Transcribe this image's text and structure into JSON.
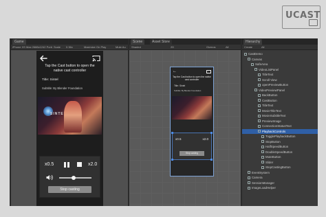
{
  "logo": {
    "text": "UCAST"
  },
  "game": {
    "tab_label": "Game",
    "toolbar": [
      "iPhone XS Max 2688x1242 Portr",
      "Scale",
      "0.36x",
      "Maximize On Play",
      "Mute Au"
    ],
    "instructions": "Tap the Cast button to open the native cast controller",
    "movie_title": "Title: Sintel",
    "movie_subtitle": "Subtitle: By Blender Foundation",
    "video_brand": "SINTEL",
    "speed_down": "x0.5",
    "speed_up": "x2.0",
    "volume_level": 0.45,
    "stop_casting": "Stop casting"
  },
  "scene": {
    "tab_label": "Scene",
    "tab2_label": "Asset Store",
    "toolbar": [
      "Shaded",
      "2D",
      "Gizmos",
      "All"
    ],
    "mini": {
      "instructions": "Tap the Cast button to open the native cast controller",
      "title": "Title: Sintel",
      "subtitle": "Subtitle: By Blender Foundation",
      "speed_down": "x0.5",
      "speed_up": "x2.0",
      "stop_casting": "Stop casting"
    }
  },
  "hierarchy": {
    "tab_label": "Hierarchy",
    "toolbar": [
      "Create",
      "All"
    ],
    "items": [
      {
        "label": "CastDemo",
        "level": 0,
        "selected": false
      },
      {
        "label": "Canvas",
        "level": 1,
        "selected": false
      },
      {
        "label": "SafeArea",
        "level": 2,
        "selected": false
      },
      {
        "label": "VideoListPanel",
        "level": 3,
        "selected": false
      },
      {
        "label": "TitleText",
        "level": 4,
        "selected": false
      },
      {
        "label": "Scroll View",
        "level": 4,
        "selected": false
      },
      {
        "label": "openPreviewButton",
        "level": 4,
        "selected": false
      },
      {
        "label": "VideoPreviewPanel",
        "level": 3,
        "selected": false
      },
      {
        "label": "BackButton",
        "level": 4,
        "selected": false
      },
      {
        "label": "CastButton",
        "level": 4,
        "selected": false
      },
      {
        "label": "TitleText",
        "level": 4,
        "selected": false
      },
      {
        "label": "MovieTitleText",
        "level": 4,
        "selected": false
      },
      {
        "label": "MovieSubtitleText",
        "level": 4,
        "selected": false
      },
      {
        "label": "PreviewImage",
        "level": 4,
        "selected": false
      },
      {
        "label": "ConnectionStatusText",
        "level": 4,
        "selected": false
      },
      {
        "label": "PlaybackControls",
        "level": 4,
        "selected": true
      },
      {
        "label": "TogglePlaybackButton",
        "level": 5,
        "selected": false
      },
      {
        "label": "StopButton",
        "level": 5,
        "selected": false
      },
      {
        "label": "HalfSpeedButton",
        "level": 5,
        "selected": false
      },
      {
        "label": "DoubleSpeedButton",
        "level": 5,
        "selected": false
      },
      {
        "label": "MuteButton",
        "level": 5,
        "selected": false
      },
      {
        "label": "Slider",
        "level": 5,
        "selected": false
      },
      {
        "label": "StopCastingButton",
        "level": 5,
        "selected": false
      },
      {
        "label": "EventSystem",
        "level": 1,
        "selected": false
      },
      {
        "label": "Camera",
        "level": 1,
        "selected": false
      },
      {
        "label": "SessionManager",
        "level": 1,
        "selected": false
      },
      {
        "label": "ImageLoadHelper",
        "level": 1,
        "selected": false
      }
    ]
  }
}
